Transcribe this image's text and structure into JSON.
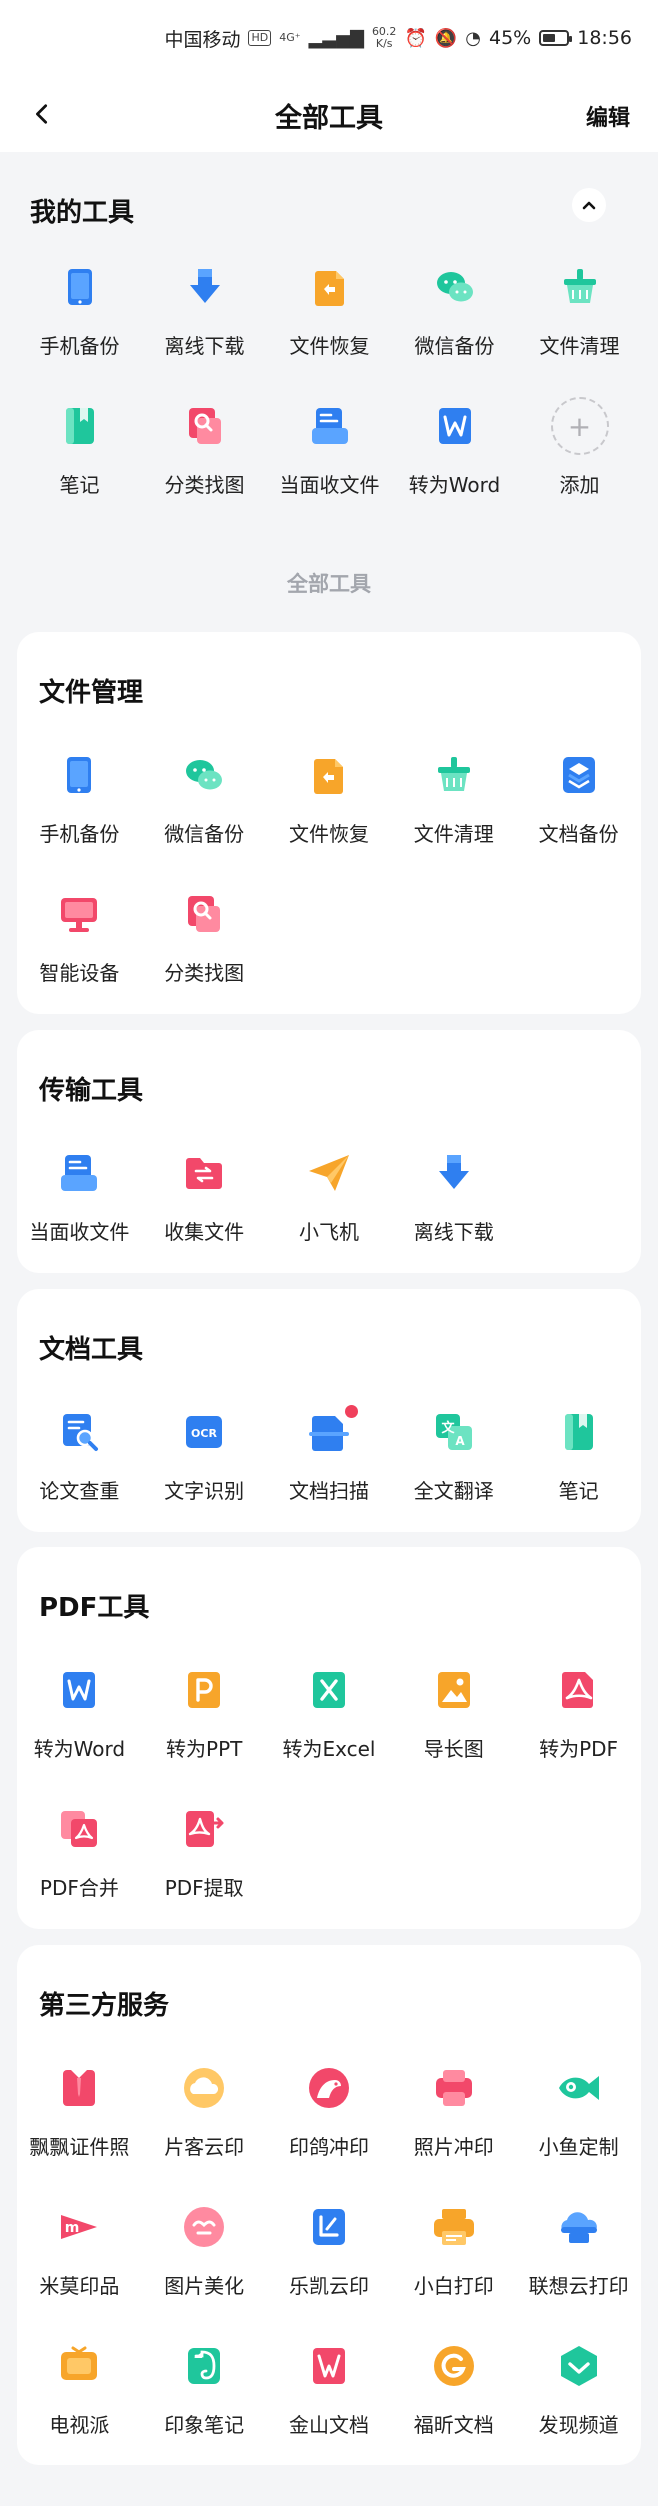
{
  "status_bar": {
    "carrier": "中国移动",
    "network_badge": "HD",
    "network_type": "4G⁺",
    "speed_value": "60.2",
    "speed_unit": "K/s",
    "battery": "45%",
    "time": "18:56"
  },
  "nav": {
    "title": "全部工具",
    "edit_label": "编辑"
  },
  "my_tools": {
    "title": "我的工具",
    "items": [
      {
        "label": "手机备份",
        "icon": "phone-backup-icon"
      },
      {
        "label": "离线下载",
        "icon": "download-arrow-icon"
      },
      {
        "label": "文件恢复",
        "icon": "file-restore-icon"
      },
      {
        "label": "微信备份",
        "icon": "wechat-icon"
      },
      {
        "label": "文件清理",
        "icon": "cleaner-basket-icon"
      },
      {
        "label": "笔记",
        "icon": "notebook-icon"
      },
      {
        "label": "分类找图",
        "icon": "image-search-icon"
      },
      {
        "label": "当面收文件",
        "icon": "receive-file-icon"
      },
      {
        "label": "转为Word",
        "icon": "word-icon"
      },
      {
        "label": "添加",
        "icon": "add-icon"
      }
    ]
  },
  "all_tools_label": "全部工具",
  "sections": [
    {
      "title": "文件管理",
      "items": [
        {
          "label": "手机备份",
          "icon": "phone-backup-icon"
        },
        {
          "label": "微信备份",
          "icon": "wechat-icon"
        },
        {
          "label": "文件恢复",
          "icon": "file-restore-icon"
        },
        {
          "label": "文件清理",
          "icon": "cleaner-basket-icon"
        },
        {
          "label": "文档备份",
          "icon": "document-backup-icon"
        },
        {
          "label": "智能设备",
          "icon": "smart-device-icon"
        },
        {
          "label": "分类找图",
          "icon": "image-search-icon"
        }
      ]
    },
    {
      "title": "传输工具",
      "items": [
        {
          "label": "当面收文件",
          "icon": "receive-file-icon"
        },
        {
          "label": "收集文件",
          "icon": "collect-folder-icon"
        },
        {
          "label": "小飞机",
          "icon": "paper-plane-icon"
        },
        {
          "label": "离线下载",
          "icon": "download-arrow-icon"
        }
      ]
    },
    {
      "title": "文档工具",
      "items": [
        {
          "label": "论文查重",
          "icon": "paper-check-icon"
        },
        {
          "label": "文字识别",
          "icon": "ocr-icon"
        },
        {
          "label": "文档扫描",
          "icon": "document-scan-icon"
        },
        {
          "label": "全文翻译",
          "icon": "translate-icon"
        },
        {
          "label": "笔记",
          "icon": "notebook-icon"
        }
      ]
    },
    {
      "title": "PDF工具",
      "items": [
        {
          "label": "转为Word",
          "icon": "word-icon"
        },
        {
          "label": "转为PPT",
          "icon": "ppt-icon"
        },
        {
          "label": "转为Excel",
          "icon": "excel-icon"
        },
        {
          "label": "导长图",
          "icon": "long-image-icon"
        },
        {
          "label": "转为PDF",
          "icon": "pdf-icon"
        },
        {
          "label": "PDF合并",
          "icon": "pdf-merge-icon"
        },
        {
          "label": "PDF提取",
          "icon": "pdf-extract-icon"
        }
      ]
    },
    {
      "title": "第三方服务",
      "items": [
        {
          "label": "飘飘证件照",
          "icon": "id-photo-icon"
        },
        {
          "label": "片客云印",
          "icon": "cloud-print-icon"
        },
        {
          "label": "印鸽冲印",
          "icon": "pigeon-print-icon"
        },
        {
          "label": "照片冲印",
          "icon": "photo-print-icon"
        },
        {
          "label": "小鱼定制",
          "icon": "fish-custom-icon"
        },
        {
          "label": "米莫印品",
          "icon": "mimo-print-icon"
        },
        {
          "label": "图片美化",
          "icon": "image-beautify-icon"
        },
        {
          "label": "乐凯云印",
          "icon": "lucky-print-icon"
        },
        {
          "label": "小白打印",
          "icon": "printer-icon"
        },
        {
          "label": "联想云打印",
          "icon": "lenovo-cloud-print-icon"
        },
        {
          "label": "电视派",
          "icon": "tv-cast-icon"
        },
        {
          "label": "印象笔记",
          "icon": "evernote-icon"
        },
        {
          "label": "金山文档",
          "icon": "kdocs-icon"
        },
        {
          "label": "福昕文档",
          "icon": "foxit-icon"
        },
        {
          "label": "发现频道",
          "icon": "discover-icon"
        }
      ]
    }
  ],
  "colors": {
    "blue": "#2f7ff0",
    "green": "#1fc69c",
    "orange": "#f7a52a",
    "red": "#f2486a",
    "background": "#f4f5f7"
  }
}
